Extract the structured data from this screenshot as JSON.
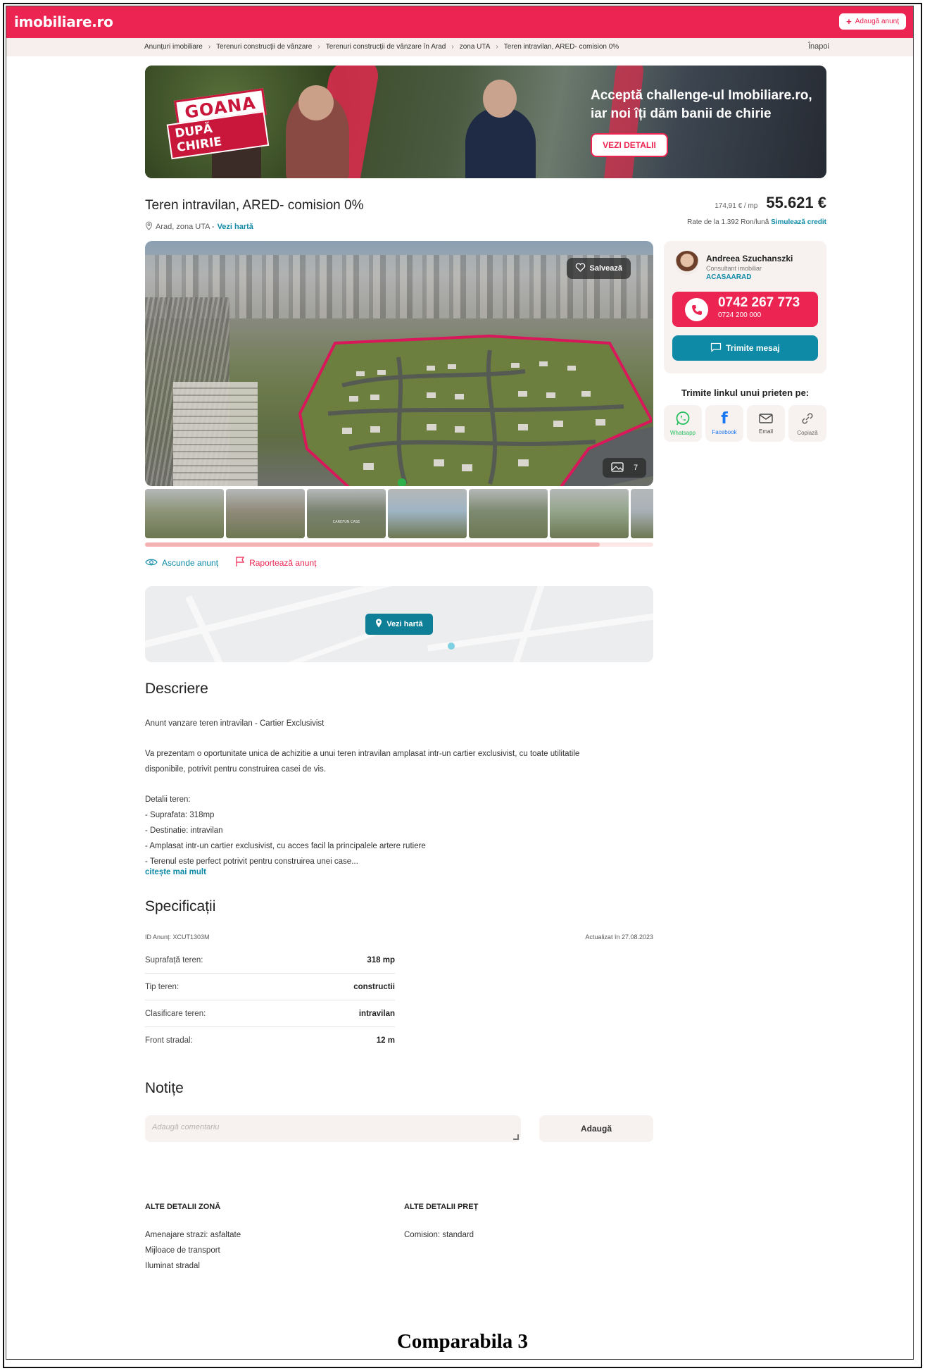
{
  "header": {
    "logo": "imobiliare.ro",
    "add_button": "Adaugă anunț"
  },
  "breadcrumb": {
    "items": [
      "Anunțuri imobiliare",
      "Terenuri construcții de vânzare",
      "Terenuri construcții de vânzare în Arad",
      "zona UTA",
      "Teren intravilan, ARED- comision 0%"
    ],
    "separator": "›",
    "back": "Înapoi"
  },
  "banner": {
    "badge_line1": "GOANA",
    "badge_line2": "DUPĂ CHIRIE",
    "headline_line1": "Acceptă challenge-ul Imobiliare.ro,",
    "headline_line2": "iar noi îți dăm banii de chirie",
    "button": "VEZI DETALII"
  },
  "listing": {
    "title": "Teren intravilan, ARED- comision 0%",
    "location": "Arad, zona UTA -",
    "map_link": "Vezi hartă",
    "price_per_sqm": "174,91 € / mp",
    "price": "55.621 €",
    "rates_text": "Rate de la 1.392 Ron/lună",
    "simulate_link": "Simulează credit"
  },
  "gallery": {
    "save_label": "Salvează",
    "photo_count": "7",
    "thumb_colors": [
      "#8d9478",
      "#8f8a79",
      "#7a8270",
      "#9fb4c4",
      "#7d8a70",
      "#93a58a",
      "#a8b0b7"
    ],
    "scroll_position": 0.895,
    "thumb_caption": "CAREFUN CASE"
  },
  "actions": {
    "hide": "Ascunde anunț",
    "report": "Raportează anunț"
  },
  "map": {
    "button": "Vezi hartă"
  },
  "agent": {
    "name": "Andreea Szuchanszki",
    "role": "Consultant imobiliar",
    "agency": "ACASAARAD",
    "phone_main": "0742 267 773",
    "phone_secondary": "0724 200 000",
    "message_button": "Trimite mesaj"
  },
  "share": {
    "title": "Trimite linkul unui prieten pe:",
    "items": [
      {
        "label": "Whatsapp",
        "icon": "whatsapp-icon",
        "color": "#25c05c"
      },
      {
        "label": "Facebook",
        "icon": "facebook-icon",
        "color": "#1877f2"
      },
      {
        "label": "Email",
        "icon": "email-icon",
        "color": "#444444"
      },
      {
        "label": "Copiază",
        "icon": "link-icon",
        "color": "#666666"
      }
    ]
  },
  "description": {
    "heading": "Descriere",
    "para1": "Anunt vanzare teren intravilan - Cartier Exclusivist",
    "para2_line1": "Va prezentam o oportunitate unica de achizitie a unui teren intravilan amplasat intr-un cartier exclusivist, cu toate utilitatile",
    "para2_line2": "disponibile, potrivit pentru construirea casei de vis.",
    "details_title": "Detalii teren:",
    "details": [
      "- Suprafata: 318mp",
      "- Destinatie: intravilan",
      "- Amplasat intr-un cartier exclusivist, cu acces facil la principalele artere rutiere",
      "- Terenul este perfect potrivit pentru construirea unei case..."
    ],
    "read_more": "citește mai mult"
  },
  "specs": {
    "heading": "Specificații",
    "id_label": "ID Anunț: XCUT1303M",
    "updated": "Actualizat în 27.08.2023",
    "rows": [
      {
        "k": "Suprafață teren:",
        "v": "318 mp"
      },
      {
        "k": "Tip teren:",
        "v": "constructii"
      },
      {
        "k": "Clasificare teren:",
        "v": "intravilan"
      },
      {
        "k": "Front stradal:",
        "v": "12 m"
      }
    ]
  },
  "notes": {
    "heading": "Notițe",
    "placeholder": "Adaugă comentariu",
    "button": "Adaugă"
  },
  "other": {
    "zone_heading": "ALTE DETALII ZONĂ",
    "zone_items": [
      "Amenajare strazi: asfaltate",
      "Mijloace de transport",
      "Iluminat stradal"
    ],
    "price_heading": "ALTE DETALII PREȚ",
    "price_items": [
      "Comision: standard"
    ]
  },
  "caption": "Comparabila 3",
  "colors": {
    "brand": "#ec2451",
    "link": "#0e8aa6",
    "soft_bg": "#f7f1f0"
  }
}
